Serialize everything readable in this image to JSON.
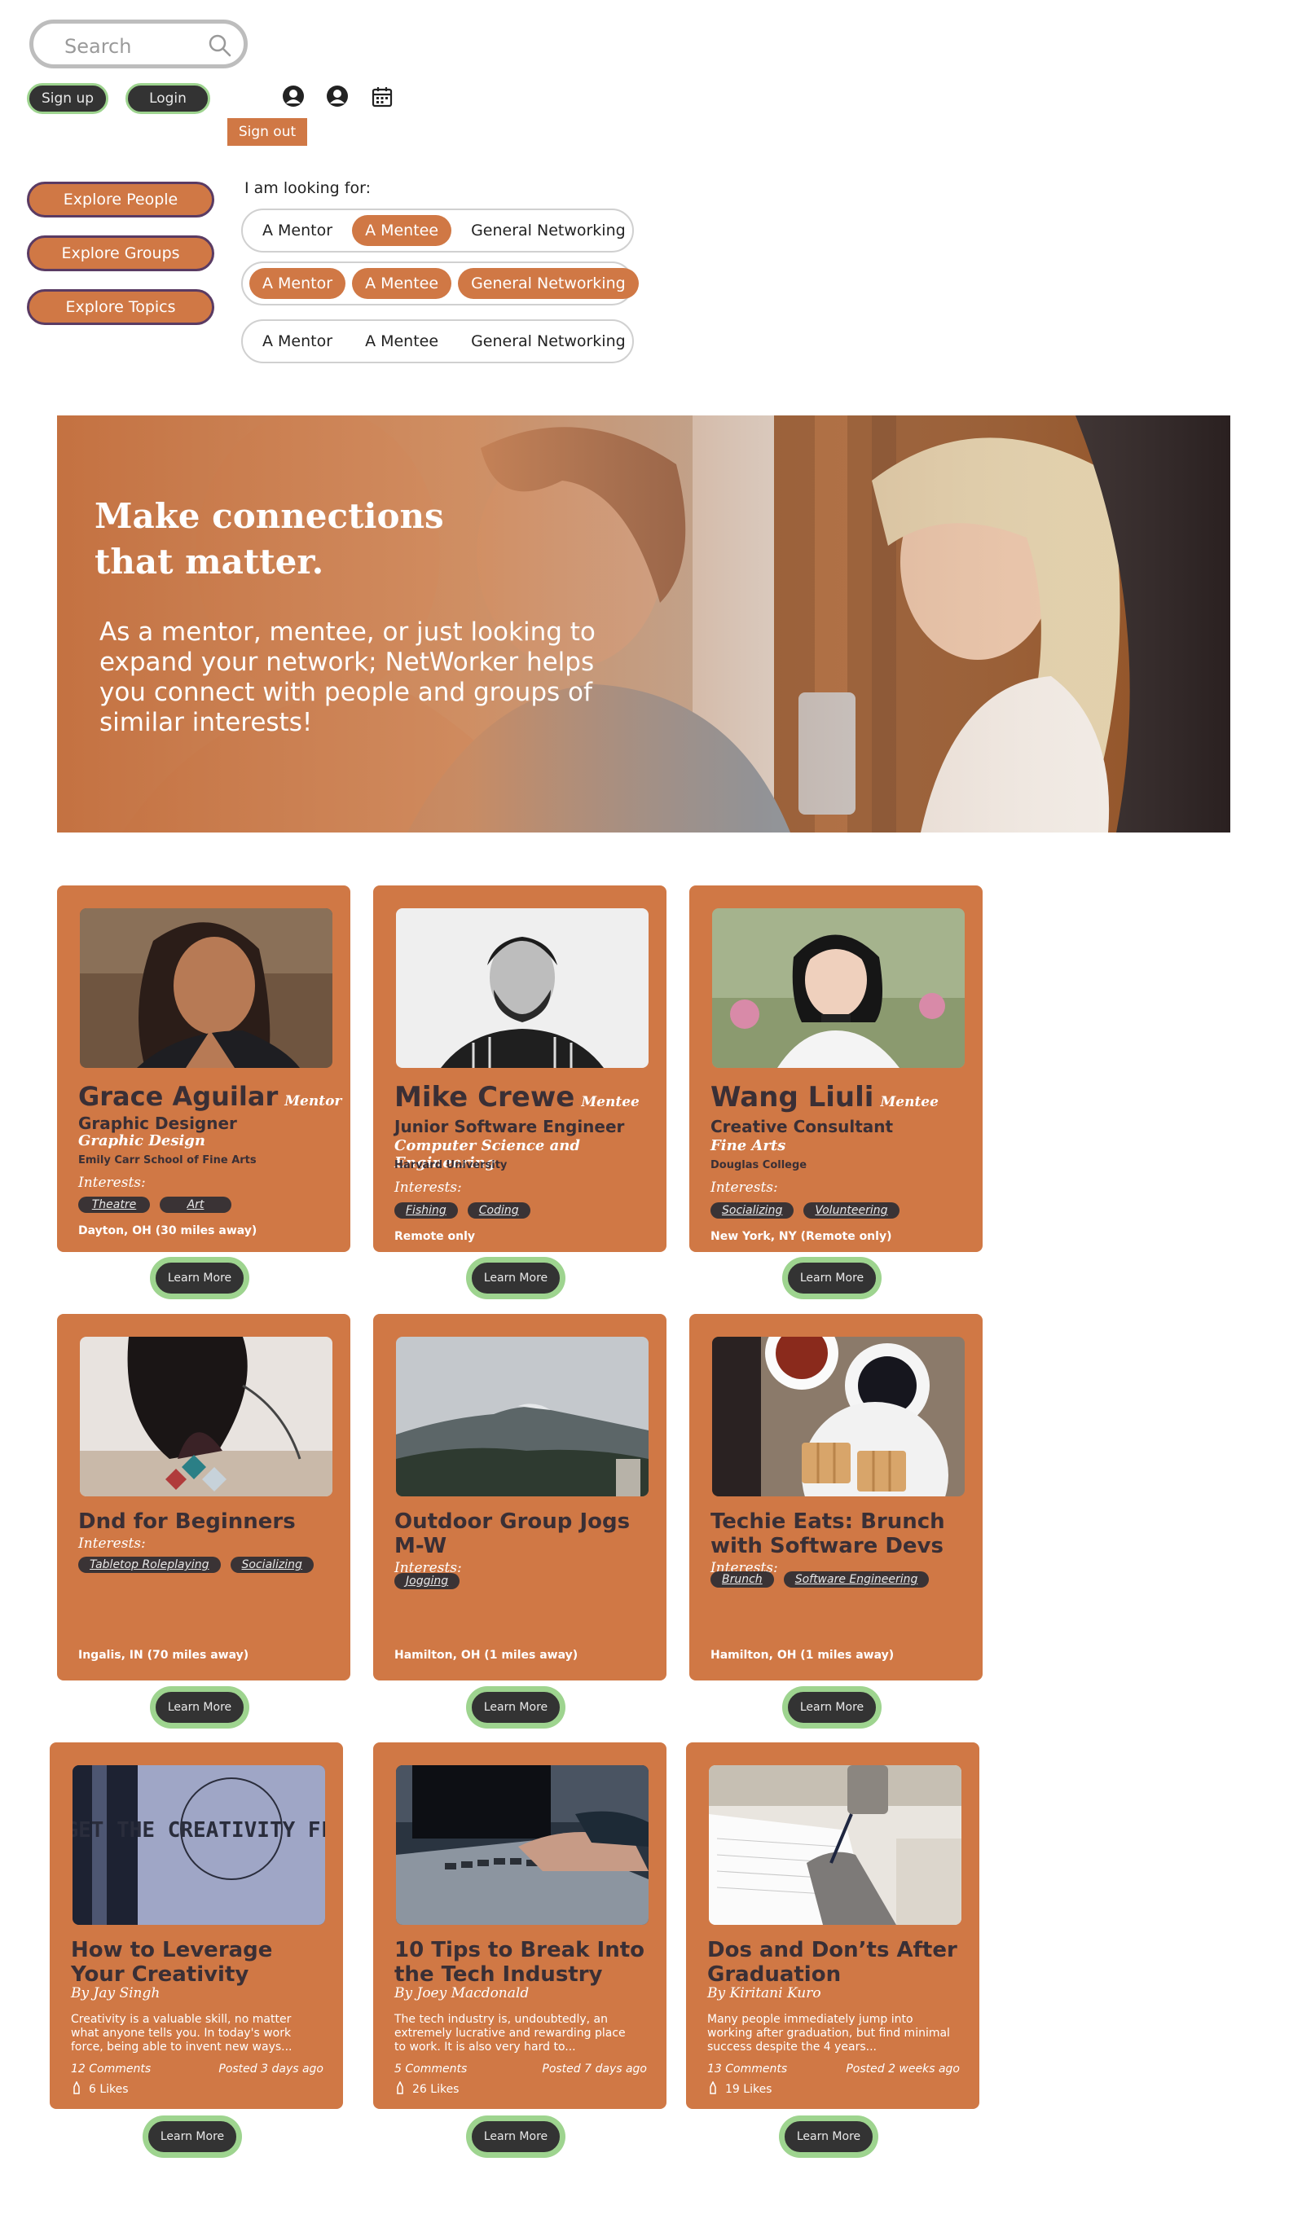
{
  "search": {
    "placeholder": "Search"
  },
  "header": {
    "signup_label": "Sign up",
    "login_label": "Login",
    "signout_label": "Sign out",
    "icons": [
      "user-circle-icon",
      "user-circle-icon",
      "calendar-icon"
    ]
  },
  "explore": {
    "people_label": "Explore People",
    "groups_label": "Explore Groups",
    "topics_label": "Explore Topics"
  },
  "looking_for": {
    "label": "I am looking for:",
    "options": [
      "A Mentor",
      "A Mentee",
      "General Networking"
    ],
    "rows": [
      {
        "selected": [
          "A Mentee"
        ]
      },
      {
        "selected": [
          "A Mentor",
          "A Mentee",
          "General Networking"
        ]
      },
      {
        "selected": []
      }
    ]
  },
  "hero": {
    "title": "Make connections that matter.",
    "body": "As a mentor, mentee, or just looking to expand your network; NetWorker helps you connect with people and groups of similar interests!"
  },
  "people": [
    {
      "name": "Grace Aguilar",
      "role": "Mentor",
      "title": "Graphic Designer",
      "field": "Graphic Design",
      "school": "Emily Carr School of Fine Arts",
      "interests_label": "Interests:",
      "interests": [
        "Theatre",
        "Art"
      ],
      "location": "Dayton, OH (30 miles away)",
      "button": "Learn More"
    },
    {
      "name": "Mike Crewe",
      "role": "Mentee",
      "title": "Junior Software Engineer",
      "field": "Computer Science and Engineering",
      "school": "Harvard University",
      "interests_label": "Interests:",
      "interests": [
        "Fishing",
        "Coding"
      ],
      "location": "Remote only",
      "button": "Learn More"
    },
    {
      "name": "Wang Liuli",
      "role": "Mentee",
      "title": "Creative Consultant",
      "field": "Fine Arts",
      "school": "Douglas College",
      "interests_label": "Interests:",
      "interests": [
        "Socializing",
        "Volunteering"
      ],
      "location": "New York, NY (Remote only)",
      "button": "Learn More"
    }
  ],
  "groups": [
    {
      "title": "Dnd for Beginners",
      "interests_label": "Interests:",
      "interests": [
        "Tabletop Roleplaying",
        "Socializing"
      ],
      "location": "Ingalis, IN (70 miles away)",
      "button": "Learn More"
    },
    {
      "title": "Outdoor Group Jogs M-W",
      "interests_label": "Interests:",
      "interests": [
        "Jogging"
      ],
      "location": "Hamilton, OH (1 miles away)",
      "button": "Learn More"
    },
    {
      "title": "Techie Eats: Brunch with Software Devs",
      "interests_label": "Interests:",
      "interests": [
        "Brunch",
        "Software Engineering"
      ],
      "location": "Hamilton, OH (1 miles away)",
      "button": "Learn More"
    }
  ],
  "topics": [
    {
      "title": "How to Leverage Your Creativity",
      "author": "By Jay Singh",
      "excerpt": "Creativity is a valuable skill, no matter what anyone tells you. In today's work force, being able to invent new ways...",
      "comments": "12 Comments",
      "posted": "Posted 3 days ago",
      "likes": "6 Likes",
      "button": "Learn More",
      "photo_text": "GET THE CREATIVITY FLOWING"
    },
    {
      "title": "10 Tips to Break Into the Tech Industry",
      "author": "By Joey Macdonald",
      "excerpt": "The tech industry is, undoubtedly, an extremely lucrative and rewarding place to work. It is also very hard to...",
      "comments": "5 Comments",
      "posted": "Posted 7 days ago",
      "likes": "26 Likes",
      "button": "Learn More"
    },
    {
      "title": "Dos and Don’ts After Graduation",
      "author": "By Kiritani Kuro",
      "excerpt": "Many people immediately jump into working after graduation, but find minimal success despite the 4 years...",
      "comments": "13 Comments",
      "posted": "Posted 2 weeks ago",
      "likes": "19 Likes",
      "button": "Learn More"
    }
  ],
  "colors": {
    "accent": "#d07845",
    "dark": "#333333",
    "glow": "#9ed48f",
    "text_dark": "#3a2f35"
  }
}
